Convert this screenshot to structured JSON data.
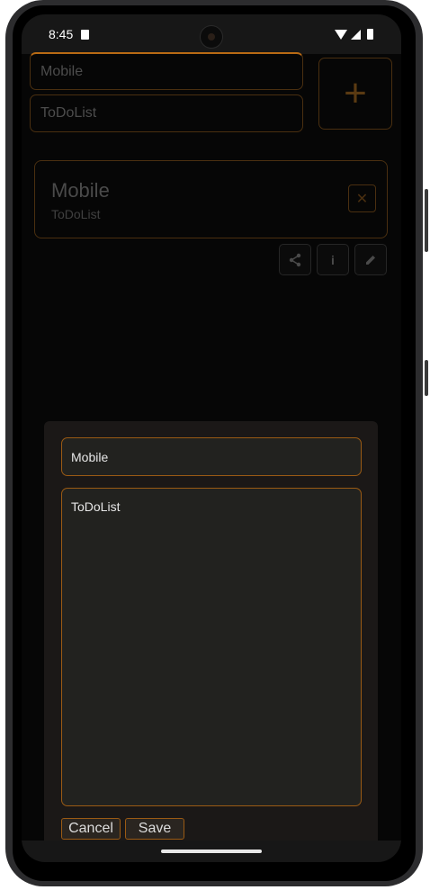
{
  "status_bar": {
    "time": "8:45"
  },
  "main": {
    "title_input": "Mobile",
    "description_input": "ToDoList",
    "add_button": "+"
  },
  "card": {
    "title": "Mobile",
    "subtitle": "ToDoList",
    "close_symbol": "✕"
  },
  "actions": {
    "info_symbol": "i"
  },
  "dialog": {
    "title_value": "Mobile",
    "body_value": "ToDoList",
    "cancel_label": "Cancel",
    "save_label": "Save"
  },
  "colors": {
    "accent": "#9a5a14",
    "background": "#060606",
    "dialog_bg": "#1b1817"
  },
  "icons": [
    "sd-card-icon",
    "camera",
    "wifi-icon",
    "signal-icon",
    "battery-icon",
    "plus-icon",
    "close-icon",
    "share-icon",
    "info-icon",
    "edit-icon"
  ]
}
